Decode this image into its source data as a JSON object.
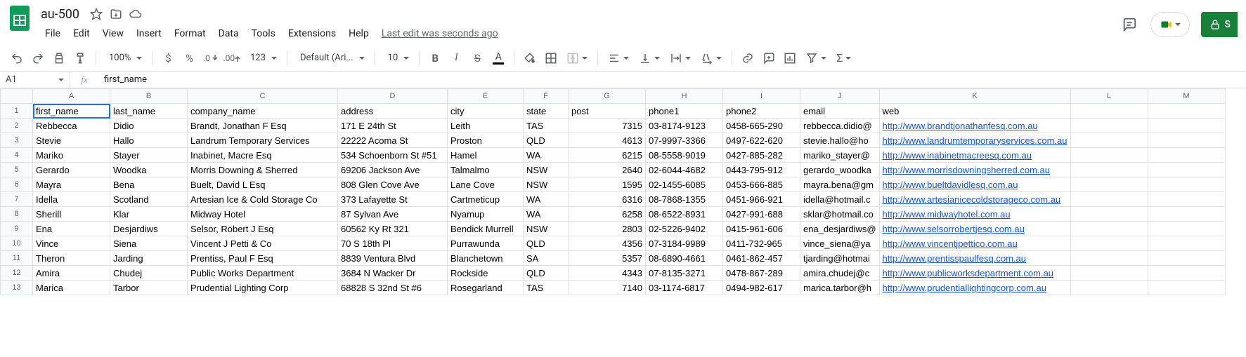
{
  "doc": {
    "name": "au-500",
    "last_edit": "Last edit was seconds ago"
  },
  "menus": [
    "File",
    "Edit",
    "View",
    "Insert",
    "Format",
    "Data",
    "Tools",
    "Extensions",
    "Help"
  ],
  "toolbar": {
    "zoom": "100%",
    "font": "Default (Ari...",
    "size": "10",
    "share": "S"
  },
  "namebox": "A1",
  "formula": "first_name",
  "columns": [
    "A",
    "B",
    "C",
    "D",
    "E",
    "F",
    "G",
    "H",
    "I",
    "J",
    "K",
    "L",
    "M"
  ],
  "headers": [
    "first_name",
    "last_name",
    "company_name",
    "address",
    "city",
    "state",
    "post",
    "phone1",
    "phone2",
    "email",
    "web"
  ],
  "rows": [
    {
      "n": 2,
      "c": [
        "Rebbecca",
        "Didio",
        "Brandt, Jonathan F Esq",
        "171 E 24th St",
        "Leith",
        "TAS",
        "7315",
        "03-8174-9123",
        "0458-665-290",
        "rebbecca.didio@",
        "http://www.brandtjonathanfesq.com.au"
      ]
    },
    {
      "n": 3,
      "c": [
        "Stevie",
        "Hallo",
        "Landrum Temporary Services",
        "22222 Acoma St",
        "Proston",
        "QLD",
        "4613",
        "07-9997-3366",
        "0497-622-620",
        "stevie.hallo@ho",
        "http://www.landrumtemporaryservices.com.au"
      ]
    },
    {
      "n": 4,
      "c": [
        "Mariko",
        "Stayer",
        "Inabinet, Macre Esq",
        "534 Schoenborn St #51",
        "Hamel",
        "WA",
        "6215",
        "08-5558-9019",
        "0427-885-282",
        "mariko_stayer@",
        "http://www.inabinetmacreesq.com.au"
      ]
    },
    {
      "n": 5,
      "c": [
        "Gerardo",
        "Woodka",
        "Morris Downing & Sherred",
        "69206 Jackson Ave",
        "Talmalmo",
        "NSW",
        "2640",
        "02-6044-4682",
        "0443-795-912",
        "gerardo_woodka",
        "http://www.morrisdowningsherred.com.au"
      ]
    },
    {
      "n": 6,
      "c": [
        "Mayra",
        "Bena",
        "Buelt, David L Esq",
        "808 Glen Cove Ave",
        "Lane Cove",
        "NSW",
        "1595",
        "02-1455-6085",
        "0453-666-885",
        "mayra.bena@gm",
        "http://www.bueltdavidlesq.com.au"
      ]
    },
    {
      "n": 7,
      "c": [
        "Idella",
        "Scotland",
        "Artesian Ice & Cold Storage Co",
        "373 Lafayette St",
        "Cartmeticup",
        "WA",
        "6316",
        "08-7868-1355",
        "0451-966-921",
        "idella@hotmail.c",
        "http://www.artesianicecoldstorageco.com.au"
      ]
    },
    {
      "n": 8,
      "c": [
        "Sherill",
        "Klar",
        "Midway Hotel",
        "87 Sylvan Ave",
        "Nyamup",
        "WA",
        "6258",
        "08-6522-8931",
        "0427-991-688",
        "sklar@hotmail.co",
        "http://www.midwayhotel.com.au"
      ]
    },
    {
      "n": 9,
      "c": [
        "Ena",
        "Desjardiws",
        "Selsor, Robert J Esq",
        "60562 Ky Rt 321",
        "Bendick Murrell",
        "NSW",
        "2803",
        "02-5226-9402",
        "0415-961-606",
        "ena_desjardiws@",
        "http://www.selsorrobertjesq.com.au"
      ]
    },
    {
      "n": 10,
      "c": [
        "Vince",
        "Siena",
        "Vincent J Petti & Co",
        "70 S 18th Pl",
        "Purrawunda",
        "QLD",
        "4356",
        "07-3184-9989",
        "0411-732-965",
        "vince_siena@ya",
        "http://www.vincentjpettico.com.au"
      ]
    },
    {
      "n": 11,
      "c": [
        "Theron",
        "Jarding",
        "Prentiss, Paul F Esq",
        "8839 Ventura Blvd",
        "Blanchetown",
        "SA",
        "5357",
        "08-6890-4661",
        "0461-862-457",
        "tjarding@hotmai",
        "http://www.prentisspaulfesq.com.au"
      ]
    },
    {
      "n": 12,
      "c": [
        "Amira",
        "Chudej",
        "Public Works Department",
        "3684 N Wacker Dr",
        "Rockside",
        "QLD",
        "4343",
        "07-8135-3271",
        "0478-867-289",
        "amira.chudej@c",
        "http://www.publicworksdepartment.com.au"
      ]
    },
    {
      "n": 13,
      "c": [
        "Marica",
        "Tarbor",
        "Prudential Lighting Corp",
        "68828 S 32nd St #6",
        "Rosegarland",
        "TAS",
        "7140",
        "03-1174-6817",
        "0494-982-617",
        "marica.tarbor@h",
        "http://www.prudentiallightingcorp.com.au"
      ]
    }
  ]
}
